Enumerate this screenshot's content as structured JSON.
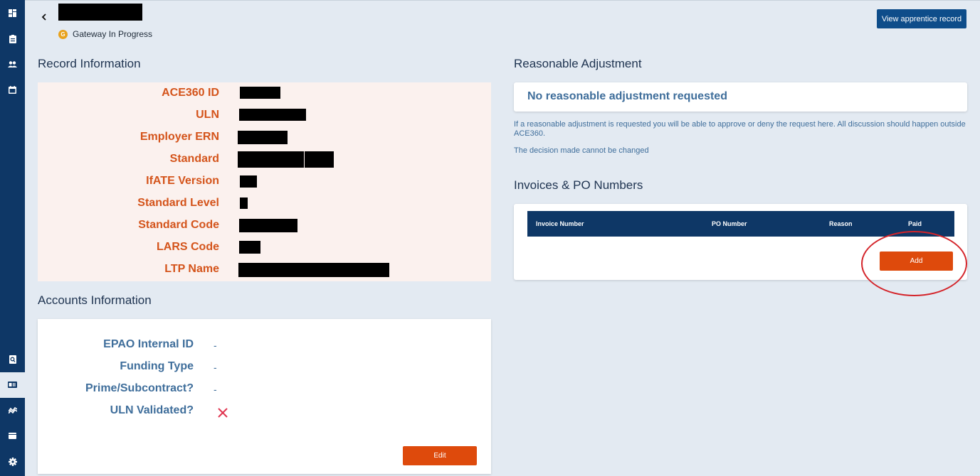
{
  "sidebar": {
    "items": [
      {
        "icon": "dashboard-icon"
      },
      {
        "icon": "clipboard-icon"
      },
      {
        "icon": "people-icon"
      },
      {
        "icon": "calendar-icon"
      },
      {
        "icon": "search-document-icon"
      },
      {
        "icon": "id-card-icon",
        "active": true
      },
      {
        "icon": "trend-icon"
      },
      {
        "icon": "folder-icon"
      },
      {
        "icon": "gear-icon"
      }
    ]
  },
  "header": {
    "status_badge": "G",
    "status_text": "Gateway In Progress",
    "view_button": "View apprentice record"
  },
  "record_info": {
    "title": "Record Information",
    "labels": [
      "ACE360 ID",
      "ULN",
      "Employer ERN",
      "Standard",
      "IfATE Version",
      "Standard Level",
      "Standard Code",
      "LARS Code",
      "LTP Name"
    ]
  },
  "accounts_info": {
    "title": "Accounts Information",
    "rows": [
      {
        "label": "EPAO Internal ID",
        "value": "-"
      },
      {
        "label": "Funding Type",
        "value": "-"
      },
      {
        "label": "Prime/Subcontract?",
        "value": "-"
      },
      {
        "label": "ULN Validated?",
        "value": ""
      }
    ],
    "edit_button": "Edit"
  },
  "reasonable_adjustment": {
    "title": "Reasonable Adjustment",
    "status": "No reasonable adjustment requested",
    "info": "If a reasonable adjustment is requested you will be able to approve or deny the request here. All discussion should happen outside ACE360.",
    "note": "The decision made cannot be changed"
  },
  "invoices": {
    "title": "Invoices & PO Numbers",
    "columns": [
      "Invoice Number",
      "PO Number",
      "Reason",
      "Paid"
    ],
    "add_button": "Add"
  },
  "colors": {
    "sidebar": "#0e3766",
    "accent_orange": "#de4a0c",
    "label_orange": "#d4541b",
    "label_blue": "#3f6e9b",
    "status_yellow": "#e8a21c"
  }
}
